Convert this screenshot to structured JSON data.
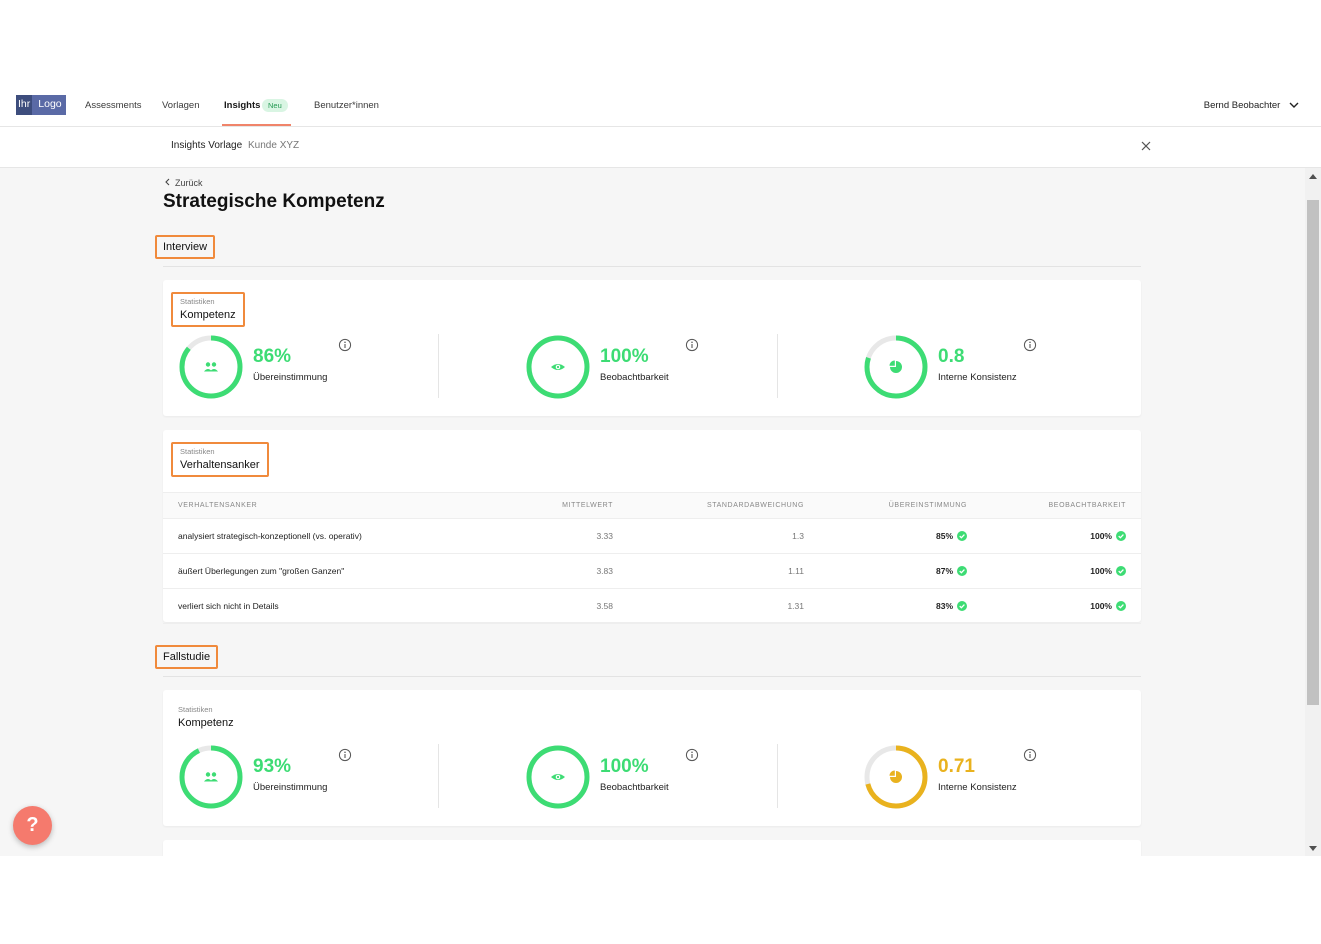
{
  "nav": {
    "logo_part1": "Ihr",
    "logo_part2": "Logo",
    "items": [
      "Assessments",
      "Vorlagen",
      "Insights",
      "Benutzer*innen"
    ],
    "new_badge": "Neu",
    "user_name": "Bernd Beobachter"
  },
  "subheader": {
    "title": "Insights Vorlage",
    "subtitle": "Kunde XYZ"
  },
  "page": {
    "back_label": "Zurück",
    "title": "Strategische Kompetenz",
    "help_label": "?"
  },
  "sections": [
    {
      "label": "Interview",
      "kompetenz": {
        "small": "Statistiken",
        "title": "Kompetenz",
        "metrics": [
          {
            "value": "86%",
            "label": "Übereinstimmung",
            "fraction": 0.86,
            "color": "#3ddc74",
            "icon": "users-icon"
          },
          {
            "value": "100%",
            "label": "Beobachtbarkeit",
            "fraction": 1.0,
            "color": "#3ddc74",
            "icon": "eye-icon"
          },
          {
            "value": "0.8",
            "label": "Interne Konsistenz",
            "fraction": 0.8,
            "color": "#3ddc74",
            "icon": "pie-icon"
          }
        ]
      },
      "anker": {
        "small": "Statistiken",
        "title": "Verhaltensanker",
        "columns": [
          "VERHALTENSANKER",
          "MITTELWERT",
          "STANDARDABWEICHUNG",
          "ÜBEREINSTIMMUNG",
          "BEOBACHTBARKEIT"
        ],
        "rows": [
          {
            "name": "analysiert strategisch-konzeptionell (vs. operativ)",
            "mean": "3.33",
            "sd": "1.3",
            "agree": "85%",
            "obs": "100%"
          },
          {
            "name": "äußert Überlegungen zum \"großen Ganzen\"",
            "mean": "3.83",
            "sd": "1.11",
            "agree": "87%",
            "obs": "100%"
          },
          {
            "name": "verliert sich nicht in Details",
            "mean": "3.58",
            "sd": "1.31",
            "agree": "83%",
            "obs": "100%"
          }
        ]
      }
    },
    {
      "label": "Fallstudie",
      "kompetenz": {
        "small": "Statistiken",
        "title": "Kompetenz",
        "metrics": [
          {
            "value": "93%",
            "label": "Übereinstimmung",
            "fraction": 0.93,
            "color": "#3ddc74",
            "icon": "users-icon"
          },
          {
            "value": "100%",
            "label": "Beobachtbarkeit",
            "fraction": 1.0,
            "color": "#3ddc74",
            "icon": "eye-icon"
          },
          {
            "value": "0.71",
            "label": "Interne Konsistenz",
            "fraction": 0.71,
            "color": "#e9b21e",
            "icon": "pie-icon"
          }
        ]
      }
    }
  ],
  "colors": {
    "accent": "#f0846a",
    "highlight": "#f08a3c",
    "green": "#3ddc74",
    "amber": "#e9b21e",
    "ring_track": "#e8e8e8"
  }
}
